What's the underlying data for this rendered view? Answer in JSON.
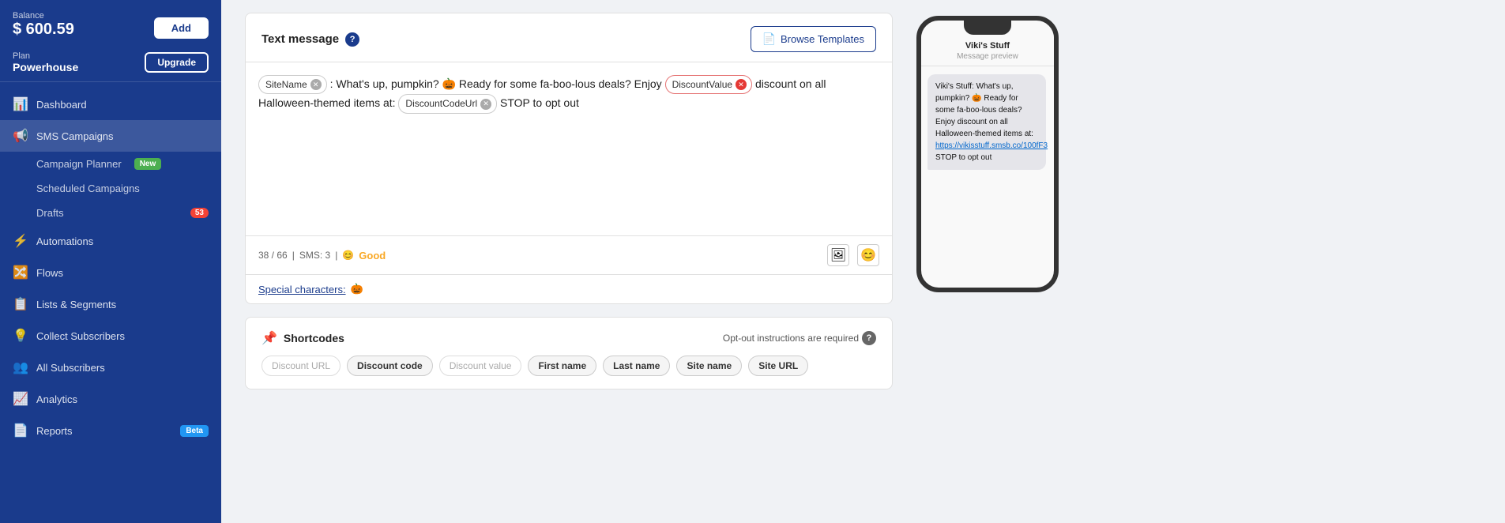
{
  "sidebar": {
    "balance_label": "Balance",
    "balance_amount": "$ 600.59",
    "add_button": "Add",
    "plan_label": "Plan",
    "plan_name": "Powerhouse",
    "upgrade_button": "Upgrade",
    "items": [
      {
        "id": "dashboard",
        "label": "Dashboard",
        "icon": "📊",
        "badge": null
      },
      {
        "id": "sms-campaigns",
        "label": "SMS Campaigns",
        "icon": "📢",
        "active": true
      },
      {
        "id": "campaign-planner",
        "label": "Campaign Planner",
        "sub": true,
        "badge_green": "New"
      },
      {
        "id": "scheduled-campaigns",
        "label": "Scheduled Campaigns",
        "sub": true
      },
      {
        "id": "drafts",
        "label": "Drafts",
        "sub": true,
        "badge_red": "53"
      },
      {
        "id": "automations",
        "label": "Automations",
        "icon": "⚡"
      },
      {
        "id": "flows",
        "label": "Flows",
        "icon": "🔀"
      },
      {
        "id": "lists-segments",
        "label": "Lists & Segments",
        "icon": "📋"
      },
      {
        "id": "collect-subscribers",
        "label": "Collect Subscribers",
        "icon": "💡"
      },
      {
        "id": "all-subscribers",
        "label": "All Subscribers",
        "icon": "👥"
      },
      {
        "id": "analytics",
        "label": "Analytics",
        "icon": "📈"
      },
      {
        "id": "reports",
        "label": "Reports",
        "icon": "📄",
        "badge_blue": "Beta"
      }
    ]
  },
  "main": {
    "text_message": {
      "title": "Text message",
      "browse_button": "Browse Templates",
      "message_parts": [
        {
          "type": "tag",
          "value": "SiteName"
        },
        {
          "type": "text",
          "value": ": What's up, pumpkin? 🎃 Ready for some fa-boo-lous deals? Enjoy "
        },
        {
          "type": "tag_red",
          "value": "DiscountValue"
        },
        {
          "type": "text",
          "value": " discount on all Halloween-themed items at: "
        },
        {
          "type": "tag",
          "value": "DiscountCodeUrl"
        },
        {
          "type": "text",
          "value": " STOP to opt out"
        }
      ],
      "stats": {
        "chars": "38 / 66",
        "sms_count": "SMS: 3",
        "sentiment": "😊",
        "sentiment_label": "Good"
      },
      "special_chars_label": "Special characters:",
      "special_chars_emoji": "🎃"
    },
    "shortcodes": {
      "title": "Shortcodes",
      "opt_out_label": "Opt-out instructions are required",
      "tags": [
        {
          "label": "Discount URL",
          "active": false
        },
        {
          "label": "Discount code",
          "active": true
        },
        {
          "label": "Discount value",
          "active": false
        },
        {
          "label": "First name",
          "active": true
        },
        {
          "label": "Last name",
          "active": true
        },
        {
          "label": "Site name",
          "active": true
        },
        {
          "label": "Site URL",
          "active": true
        }
      ]
    }
  },
  "phone_preview": {
    "sender": "Viki's Stuff",
    "label": "Message preview",
    "message": "Viki's Stuff: What's up, pumpkin? 🎃 Ready for some fa-boo-lous deals? Enjoy discount on all Halloween-themed items at: ",
    "link_text": "https://vikisstuff.smsb.co/100fF3",
    "message_end": " STOP to opt out"
  }
}
